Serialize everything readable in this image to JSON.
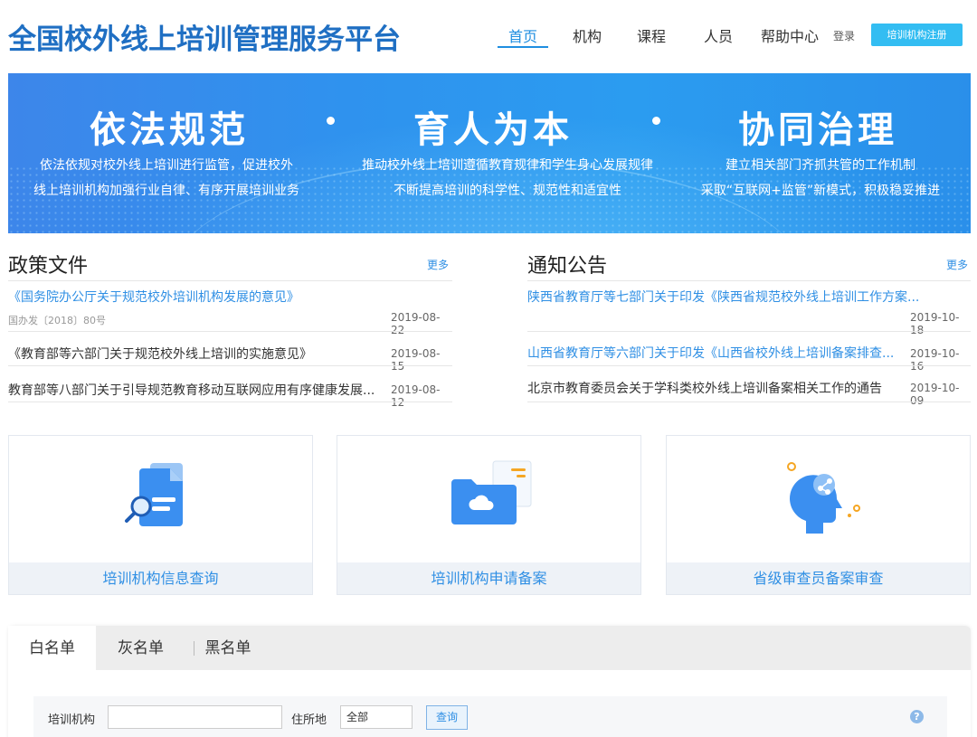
{
  "header": {
    "logo_text": "全国校外线上培训管理服务平台",
    "nav": [
      "首页",
      "机构",
      "课程",
      "人员",
      "帮助中心"
    ],
    "login": "登录",
    "register": "培训机构注册"
  },
  "banner": {
    "slogans": [
      {
        "title": "依法规范",
        "lines": [
          "依法依规对校外线上培训进行监管，促进校外",
          "线上培训机构加强行业自律、有序开展培训业务"
        ]
      },
      {
        "title": "育人为本",
        "lines": [
          "推动校外线上培训遵循教育规律和学生身心发展规律",
          "不断提高培训的科学性、规范性和适宜性"
        ]
      },
      {
        "title": "协同治理",
        "lines": [
          "建立相关部门齐抓共管的工作机制",
          "采取“互联网+监管”新模式，积极稳妥推进"
        ]
      }
    ]
  },
  "policy": {
    "title": "政策文件",
    "more": "更多",
    "items": [
      {
        "text": "《国务院办公厅关于规范校外培训机构发展的意见》",
        "sub": "国办发〔2018〕80号",
        "date": "2019-08-22"
      },
      {
        "text": "《教育部等六部门关于规范校外线上培训的实施意见》",
        "date": "2019-08-15"
      },
      {
        "text": "教育部等八部门关于引导规范教育移动互联网应用有序健康发展...",
        "date": "2019-08-12"
      }
    ]
  },
  "notice": {
    "title": "通知公告",
    "more": "更多",
    "items": [
      {
        "text": "陕西省教育厅等七部门关于印发《陕西省规范校外线上培训工作方案...",
        "date": "2019-10-18"
      },
      {
        "text": "山西省教育厅等六部门关于印发《山西省校外线上培训备案排查...",
        "date": "2019-10-16"
      },
      {
        "text": "北京市教育委员会关于学科类校外线上培训备案相关工作的通告",
        "date": "2019-10-09"
      }
    ]
  },
  "cards": [
    {
      "label": "培训机构信息查询",
      "icon": "document-search-icon"
    },
    {
      "label": "培训机构申请备案",
      "icon": "cloud-folder-icon"
    },
    {
      "label": "省级审查员备案审查",
      "icon": "head-network-icon"
    }
  ],
  "tabs": [
    "白名单",
    "灰名单",
    "黑名单"
  ],
  "filter": {
    "org_label": "培训机构",
    "org_value": "",
    "location_label": "住所地",
    "location_value": "全部",
    "query": "查询",
    "help": "?"
  },
  "colors": {
    "brand": "#1f6fc3",
    "accent": "#2f8fe4",
    "register": "#33bdf2"
  }
}
